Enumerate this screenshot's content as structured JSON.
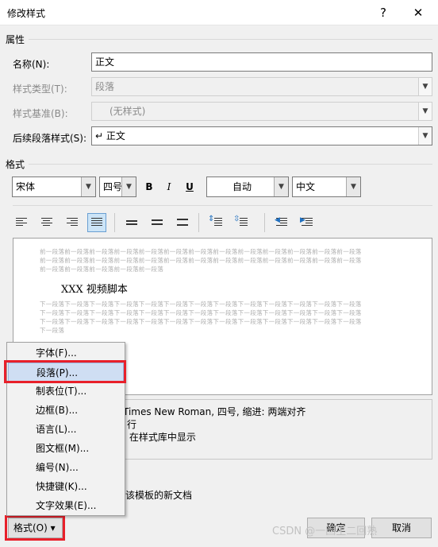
{
  "window": {
    "title": "修改样式",
    "help_glyph": "?",
    "close_glyph": "✕"
  },
  "properties": {
    "section_label": "属性",
    "name_label": "名称(N):",
    "name_value": "正文",
    "type_label": "样式类型(T):",
    "type_value": "段落",
    "base_label": "样式基准(B):",
    "base_value": "(无样式)",
    "next_label": "后续段落样式(S):",
    "next_value": "↵ 正文"
  },
  "format": {
    "section_label": "格式",
    "font": "宋体",
    "size": "四号",
    "bold": "B",
    "italic": "I",
    "underline": "U",
    "color": "自动",
    "script": "中文"
  },
  "preview": {
    "prev_lines": [
      "前一段落前一段落前一段落前一段落前一段落前一段落前一段落前一段落前一段落前一段落前一段落前一段落前一段落",
      "前一段落前一段落前一段落前一段落前一段落前一段落前一段落前一段落前一段落前一段落前一段落前一段落前一段落",
      "前一段落前一段落前一段落前一段落前一段落"
    ],
    "sample": "XXX 视频脚本",
    "next_lines": [
      "下一段落下一段落下一段落下一段落下一段落下一段落下一段落下一段落下一段落下一段落下一段落下一段落下一段落",
      "下一段落下一段落下一段落下一段落下一段落下一段落下一段落下一段落下一段落下一段落下一段落下一段落下一段落",
      "下一段落下一段落下一段落下一段落下一段落下一段落下一段落下一段落下一段落下一段落下一段落下一段落下一段落",
      "下一段落"
    ]
  },
  "description": {
    "line1": "Times New Roman, 四号, 缩进: 两端对齐",
    "line2": "行",
    "line3": ": 在样式库中显示"
  },
  "options": {
    "new_docs_partial": "该模板的新文档"
  },
  "menu": {
    "items": [
      {
        "label": "字体(F)..."
      },
      {
        "label": "段落(P)..."
      },
      {
        "label": "制表位(T)..."
      },
      {
        "label": "边框(B)..."
      },
      {
        "label": "语言(L)..."
      },
      {
        "label": "图文框(M)..."
      },
      {
        "label": "编号(N)..."
      },
      {
        "label": "快捷键(K)..."
      },
      {
        "label": "文字效果(E)..."
      }
    ]
  },
  "buttons": {
    "format_label": "格式(O) ▾",
    "ok_label": "确定",
    "cancel_label": "取消"
  },
  "watermark": "CSDN @一回生二回熟",
  "colors": {
    "highlight_red": "#e8202a",
    "menu_highlight": "#cfdef3",
    "accent": "#0078d7"
  }
}
